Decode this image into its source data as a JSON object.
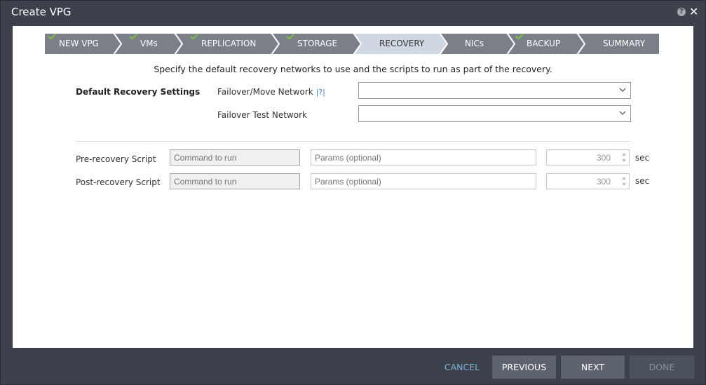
{
  "window": {
    "title": "Create VPG"
  },
  "wizard": {
    "steps": [
      {
        "label": "NEW VPG",
        "completed": true
      },
      {
        "label": "VMs",
        "completed": true
      },
      {
        "label": "REPLICATION",
        "completed": true
      },
      {
        "label": "STORAGE",
        "completed": true
      },
      {
        "label": "RECOVERY",
        "completed": false,
        "active": true
      },
      {
        "label": "NICs",
        "completed": false
      },
      {
        "label": "BACKUP",
        "completed": true
      },
      {
        "label": "SUMMARY",
        "completed": false
      }
    ],
    "colors": {
      "step": "#7a7f88",
      "active": "#cfd8e2",
      "separator": "#ffffff",
      "check": "#7bc142"
    }
  },
  "main": {
    "description": "Specify the default recovery networks to use and the scripts to run as part of the recovery.",
    "default_settings_label": "Default Recovery Settings",
    "failover_network_label": "Failover/Move Network",
    "failover_network_help": "|?|",
    "failover_network_value": "",
    "failover_test_label": "Failover Test Network",
    "failover_test_value": ""
  },
  "scripts": {
    "pre": {
      "label": "Pre-recovery Script",
      "command_placeholder": "Command to run",
      "params_placeholder": "Params (optional)",
      "timeout_value": "300",
      "unit": "sec"
    },
    "post": {
      "label": "Post-recovery Script",
      "command_placeholder": "Command to run",
      "params_placeholder": "Params (optional)",
      "timeout_value": "300",
      "unit": "sec"
    }
  },
  "footer": {
    "cancel_label": "CANCEL",
    "previous_label": "PREVIOUS",
    "next_label": "NEXT",
    "done_label": "DONE"
  }
}
